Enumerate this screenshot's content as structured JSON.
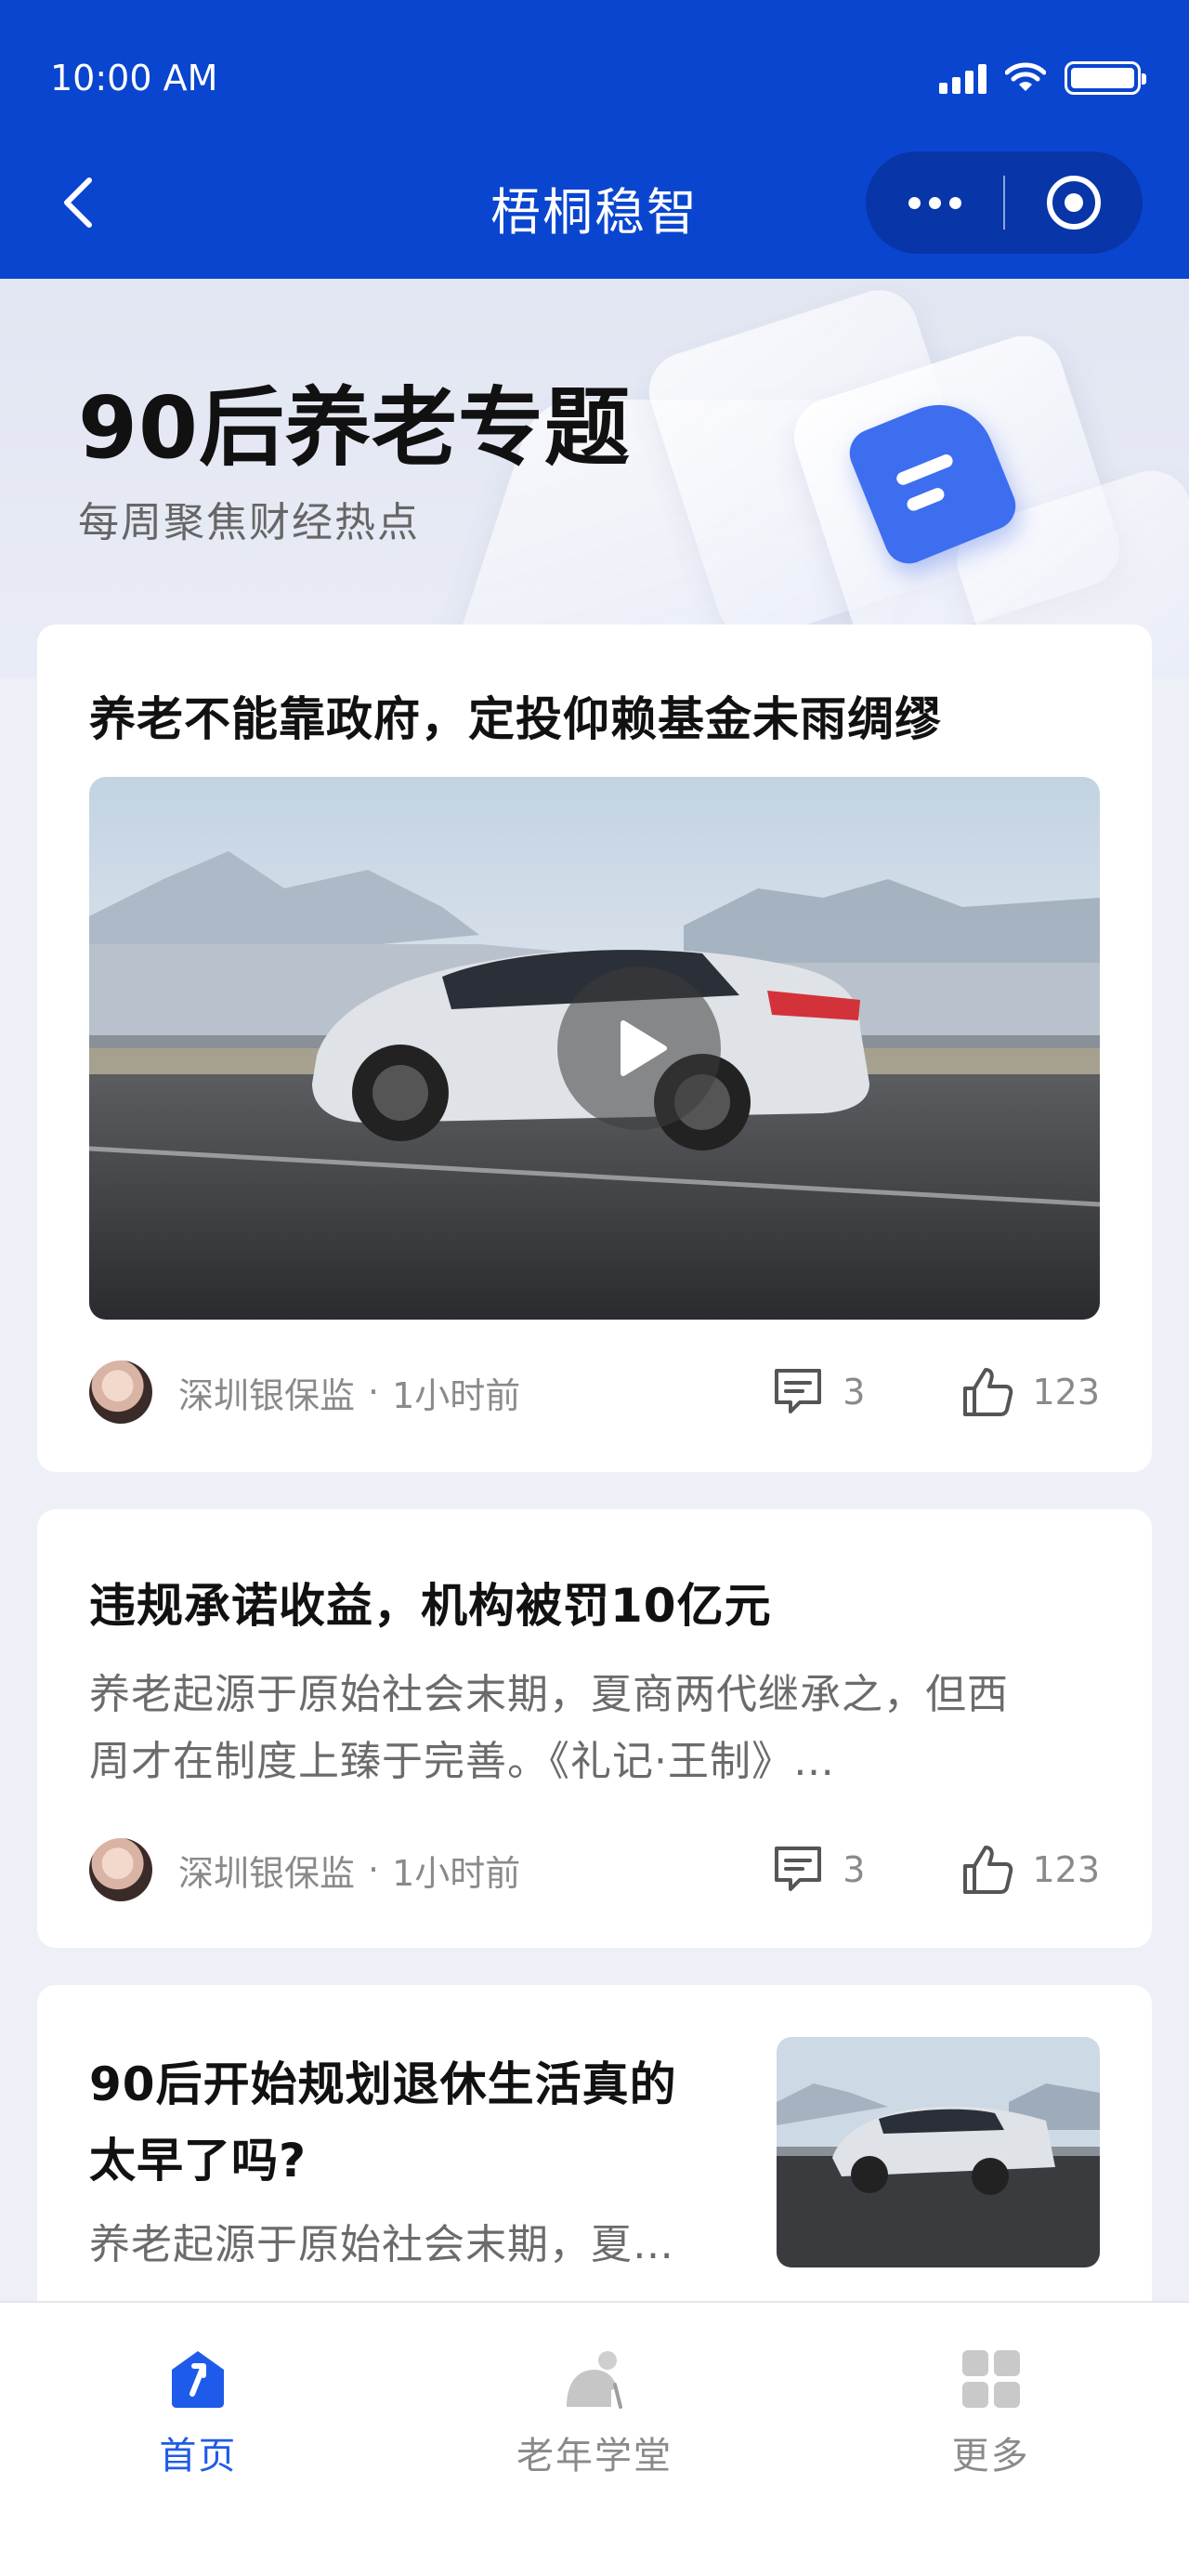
{
  "status_bar": {
    "time": "10:00 AM"
  },
  "nav": {
    "title": "梧桐稳智",
    "back_icon": "chevron-left-icon",
    "more_icon": "more-dots-icon",
    "close_icon": "target-circle-icon"
  },
  "hero": {
    "title": "90后养老专题",
    "subtitle": "每周聚焦财经热点"
  },
  "articles": [
    {
      "title": "养老不能靠政府，定投仰赖基金未雨绸缪",
      "source": "深圳银保监",
      "separator": "·",
      "time": "1小时前",
      "comments": "3",
      "likes": "123"
    },
    {
      "title": "违规承诺收益，机构被罚10亿元",
      "excerpt_line1": "养老起源于原始社会末期，夏商两代继承之，但西",
      "excerpt_line2": "周才在制度上臻于完善。《礼记·王制》…",
      "source": "深圳银保监",
      "separator": "·",
      "time": "1小时前",
      "comments": "3",
      "likes": "123"
    },
    {
      "title_line1": "90后开始规划退休生活真的",
      "title_line2": "太早了吗?",
      "excerpt": "养老起源于原始社会末期，夏…"
    }
  ],
  "tabbar": [
    {
      "label": "首页",
      "icon": "home-arrow-icon",
      "active": true
    },
    {
      "label": "老年学堂",
      "icon": "elder-icon",
      "active": false
    },
    {
      "label": "更多",
      "icon": "grid-icon",
      "active": false
    }
  ],
  "colors": {
    "primary": "#0a45d0",
    "accent": "#1f5bea",
    "background": "#eef0f7"
  }
}
